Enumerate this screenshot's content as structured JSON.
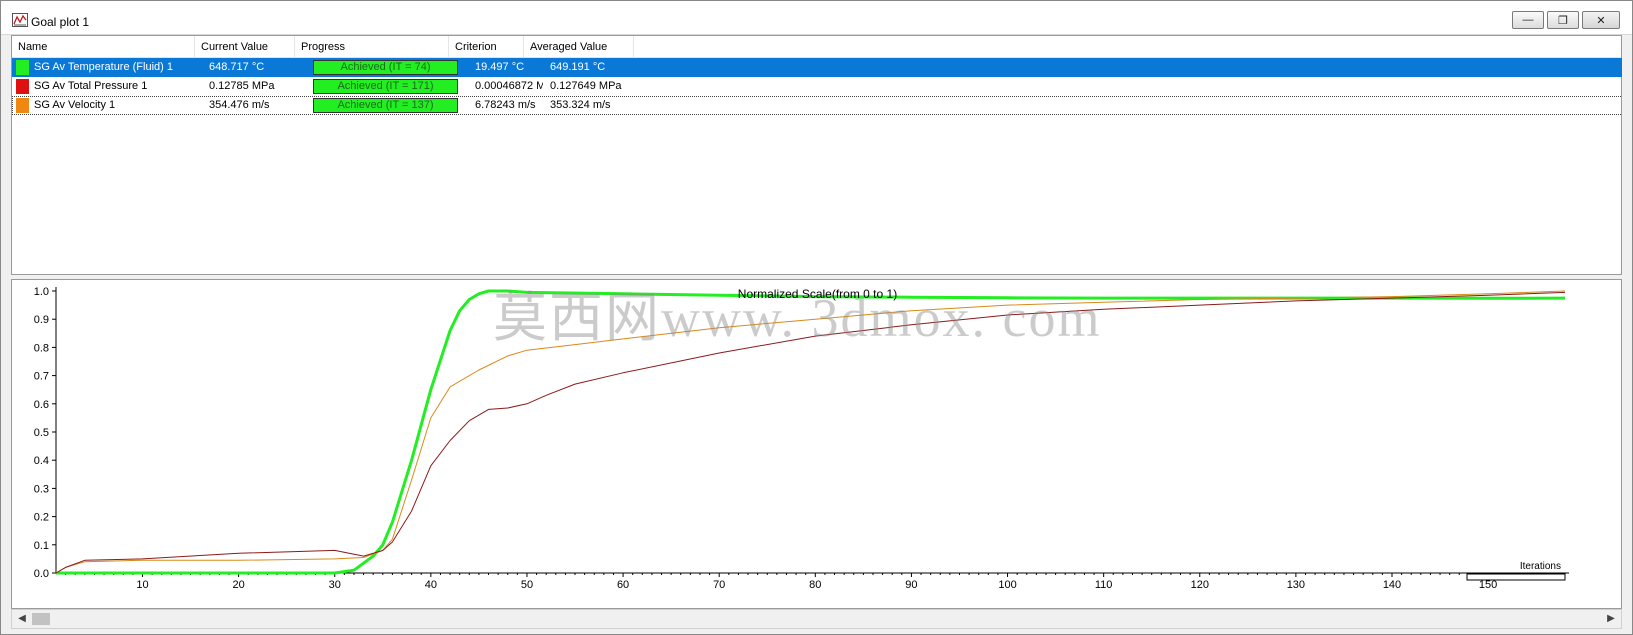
{
  "window": {
    "title": "Goal plot 1",
    "minimize": "—",
    "maximize": "❐",
    "close": "✕"
  },
  "colors": {
    "selection": "#0a78d7",
    "temperature": "#22ee22",
    "pressure": "#8b1a1a",
    "velocity": "#d88a1a",
    "progress": "#22ee22"
  },
  "table": {
    "columns": [
      "Name",
      "Current Value",
      "Progress",
      "Criterion",
      "Averaged Value"
    ],
    "rows": [
      {
        "name": "SG Av Temperature (Fluid) 1",
        "current": "648.717 °C",
        "progress": "Achieved (IT = 74)",
        "criterion": "19.497 °C",
        "averaged": "649.191 °C",
        "swatch": "#22ee22"
      },
      {
        "name": "SG Av Total Pressure 1",
        "current": "0.12785 MPa",
        "progress": "Achieved (IT = 171)",
        "criterion": "0.00046872 M",
        "averaged": "0.127649 MPa",
        "swatch": "#dd1111"
      },
      {
        "name": "SG Av Velocity 1",
        "current": "354.476 m/s",
        "progress": "Achieved (IT = 137)",
        "criterion": "6.78243 m/s",
        "averaged": "353.324 m/s",
        "swatch": "#ee8811"
      }
    ]
  },
  "watermark": "莫西网www. 3dmox. com",
  "chart_data": {
    "type": "line",
    "title": "Normalized Scale(from 0 to 1)",
    "xlabel": "Iterations",
    "ylabel": "",
    "xlim": [
      1,
      158
    ],
    "ylim": [
      0,
      1.0
    ],
    "xticks": [
      10,
      20,
      30,
      40,
      50,
      60,
      70,
      80,
      90,
      100,
      110,
      120,
      130,
      140,
      150
    ],
    "yticks": [
      0.0,
      0.1,
      0.2,
      0.3,
      0.4,
      0.5,
      0.6,
      0.7,
      0.8,
      0.9,
      1.0
    ],
    "ytick_labels": [
      "0.0",
      "0.1",
      "0.2",
      "0.3",
      "0.4",
      "0.5",
      "0.6",
      "0.7",
      "0.8",
      "0.9",
      "1.0"
    ],
    "series": [
      {
        "name": "SG Av Temperature (Fluid) 1",
        "color": "#22ee22",
        "width": 3,
        "x": [
          1,
          10,
          20,
          30,
          32,
          34,
          35,
          36,
          38,
          40,
          42,
          43,
          44,
          45,
          46,
          48,
          50,
          60,
          70,
          80,
          90,
          100,
          110,
          120,
          130,
          140,
          150,
          158
        ],
        "y": [
          0.0,
          0.0,
          0.0,
          0.0,
          0.01,
          0.06,
          0.1,
          0.18,
          0.4,
          0.65,
          0.86,
          0.93,
          0.97,
          0.99,
          1.0,
          1.0,
          0.995,
          0.99,
          0.985,
          0.98,
          0.978,
          0.976,
          0.975,
          0.975,
          0.975,
          0.975,
          0.974,
          0.975
        ]
      },
      {
        "name": "SG Av Velocity 1",
        "color": "#d88a1a",
        "width": 1,
        "x": [
          1,
          2,
          4,
          10,
          20,
          30,
          33,
          35,
          36,
          38,
          40,
          42,
          45,
          48,
          50,
          55,
          60,
          70,
          80,
          90,
          100,
          110,
          120,
          130,
          140,
          150,
          158
        ],
        "y": [
          0.0,
          0.02,
          0.04,
          0.045,
          0.045,
          0.05,
          0.055,
          0.08,
          0.12,
          0.33,
          0.55,
          0.66,
          0.72,
          0.77,
          0.79,
          0.81,
          0.83,
          0.87,
          0.9,
          0.93,
          0.95,
          0.96,
          0.97,
          0.975,
          0.98,
          0.99,
          1.0
        ]
      },
      {
        "name": "SG Av Total Pressure 1",
        "color": "#8b1a1a",
        "width": 1,
        "x": [
          1,
          2,
          4,
          10,
          20,
          30,
          33,
          35,
          36,
          38,
          40,
          42,
          44,
          46,
          48,
          50,
          52,
          55,
          60,
          70,
          80,
          90,
          100,
          110,
          120,
          130,
          140,
          150,
          158
        ],
        "y": [
          0.0,
          0.02,
          0.045,
          0.05,
          0.07,
          0.08,
          0.06,
          0.08,
          0.11,
          0.22,
          0.38,
          0.47,
          0.54,
          0.58,
          0.585,
          0.6,
          0.63,
          0.67,
          0.71,
          0.78,
          0.84,
          0.88,
          0.915,
          0.935,
          0.95,
          0.965,
          0.975,
          0.985,
          0.995
        ]
      }
    ]
  }
}
